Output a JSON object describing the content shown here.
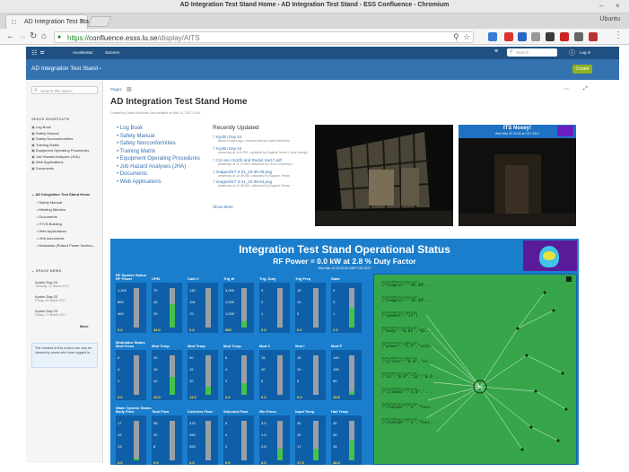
{
  "window": {
    "title": "AD Integration Test Stand Home - AD Integration Test Stand - ESS Confluence - Chromium",
    "profile": "Ubuntu"
  },
  "tab": {
    "title": "AD Integration Test Sta"
  },
  "address": {
    "url": "https://confluence.esss.lu.se/display/AITS",
    "url_scheme": "https://",
    "url_host": "confluence.esss.lu.se",
    "url_path": "/display/AITS"
  },
  "confluence_nav": {
    "items": [
      "Accelerator",
      "Science"
    ],
    "search_placeholder": "Search",
    "login": "Log in"
  },
  "space": {
    "name": "AD Integration Test Stand",
    "create": "Create"
  },
  "sidebar": {
    "search_placeholder": "Search this space",
    "shortcuts_heading": "SPACE SHORTCUTS",
    "shortcuts": [
      "Log Book",
      "Safety Manual",
      "Safety Nonconformities",
      "Training Matrix",
      "Equipment Operating Procedures",
      "Job Hazard Analyses (JHA)",
      "Web Applications",
      "Documents"
    ],
    "tree_root": "AD Integration Test Stand Home",
    "tree_children": [
      "Safety Manual",
      "Meeting Minutes",
      "Documents",
      "ITS B Building",
      "Web Applications",
      "JHA documents",
      "Modulator (Pulsed Power Section..."
    ],
    "news_heading": "SPACE NEWS",
    "news": [
      {
        "title": "Kyahn Day 24",
        "date": "Tuesday, 21 March 2017"
      },
      {
        "title": "Kyahn Day 22",
        "date": "Friday, 10 March 2017"
      },
      {
        "title": "Kyahn Day 23",
        "date": "Friday, 17 March 2017"
      }
    ],
    "news_more": "More",
    "notice": "The content of this macro can only be viewed by users who have logged in."
  },
  "page": {
    "breadcrumb": "Pages",
    "title": "AD Integration Test Stand Home",
    "byline": "Created by David McGinnis, last modified on Mar 24, 2017 10:51",
    "links": [
      "Log Book",
      "Safety Manual",
      "Safety Nonconformities",
      "Training Matrix",
      "Equipment Operating Procedures",
      "Job Hazard Analyses (JHA)",
      "Documents",
      "Web Applications"
    ],
    "recent_heading": "Recently Updated",
    "recent": [
      {
        "title": "Kyahn Day 24",
        "sub": "about 5 hours ago • commented by David McGinnis"
      },
      {
        "title": "Kyahn Day 24",
        "sub": "yesterday at 3:44 PM • updated by Eugene Tereia • view change"
      },
      {
        "title": "Cxl van cts10b and Radiot ree17.pdf",
        "sub": "yesterday at 11:13 AM • attached by Linus Johansson"
      },
      {
        "title": "image2017-3-21_10-39-35.png",
        "sub": "yesterday at 10:39 AM • attached by Eugene Tereia"
      },
      {
        "title": "image2017-3-21_10-38-54.png",
        "sub": "yesterday at 10:38 AM • attached by Eugene Tereia"
      }
    ],
    "show_more": "Show More",
    "its_title": "ITS Nosey!",
    "its_date": "Wed Mar 22 22:00 at CET 2017"
  },
  "dashboard": {
    "title": "Integration Test Stand Operational Status",
    "subtitle": "RF Power = 0.0 kW at 2.8 % Duty Factor",
    "timestamp": "Wed Mar 22 22:00:00 GMT+100 2017",
    "sections": [
      {
        "label": "RF System Status",
        "gauges": [
          {
            "label": "RF Power",
            "ticks": [
              "1,200",
              "800",
              "400"
            ],
            "value": "0.0",
            "level": 0.0
          },
          {
            "label": "CPM",
            "ticks": [
              "70",
              "40",
              "20"
            ],
            "value": "44.0",
            "level": 0.6
          },
          {
            "label": "Cath V",
            "ticks": [
              "140",
              "115",
              "70"
            ],
            "value": "0.0",
            "level": 0.0
          },
          {
            "label": "Trig W",
            "ticks": [
              "3,000",
              "2,000",
              "1,000"
            ],
            "value": "500",
            "level": 0.15
          },
          {
            "label": "Trig. Duty",
            "ticks": [
              "3",
              "2",
              "1"
            ],
            "value": "0.0",
            "level": 0.0
          },
          {
            "label": "Trig Freq",
            "ticks": [
              "15",
              "10",
              "5"
            ],
            "value": "0.0",
            "level": 0.0
          },
          {
            "label": "State",
            "ticks": [
              "4",
              "3",
              "1"
            ],
            "value": "2.0",
            "level": 0.5
          }
        ]
      },
      {
        "label": "Modulator Status",
        "gauges": [
          {
            "label": "Mod Press",
            "ticks": [
              "6",
              "4",
              "2"
            ],
            "value": "0.0",
            "level": 0.0
          },
          {
            "label": "Mod Temp",
            "ticks": [
              "20",
              "15",
              "10"
            ],
            "value": "16.0",
            "level": 0.45
          },
          {
            "label": "Mod Temp",
            "ticks": [
              "20",
              "15",
              "10"
            ],
            "value": "12.6",
            "level": 0.2
          },
          {
            "label": "Mod Temp",
            "ticks": [
              "6",
              "4",
              "2"
            ],
            "value": "2.0",
            "level": 0.3
          },
          {
            "label": "Mod V",
            "ticks": [
              "15",
              "10",
              "5"
            ],
            "value": "0.0",
            "level": 0.0
          },
          {
            "label": "Mod I",
            "ticks": [
              "15",
              "10",
              "5"
            ],
            "value": "0.0",
            "level": 0.0
          },
          {
            "label": "Mod P",
            "ticks": [
              "140",
              "100",
              "60"
            ],
            "value": "19.8",
            "level": 0.1
          }
        ]
      },
      {
        "label": "Water System Status",
        "gauges": [
          {
            "label": "Body Flow",
            "ticks": [
              "17",
              "15",
              "13"
            ],
            "value": "0.0",
            "level": 0.05
          },
          {
            "label": "Tank Flow",
            "ticks": [
              "55",
              "20",
              "8"
            ],
            "value": "0.0",
            "level": 0.0
          },
          {
            "label": "Collector Flow",
            "ticks": [
              "375",
              "290",
              "200"
            ],
            "value": "0.0",
            "level": 0.0
          },
          {
            "label": "Solenoid Flow",
            "ticks": [
              "5",
              "4",
              "2"
            ],
            "value": "0.0",
            "level": 0.0
          },
          {
            "label": "Rtn Press.",
            "ticks": [
              "3.0",
              "1.5",
              "0.8"
            ],
            "value": "0.0",
            "level": 0.3
          },
          {
            "label": "Input Temp",
            "ticks": [
              "30",
              "20",
              "17"
            ],
            "value": "17.3",
            "level": 0.3
          },
          {
            "label": "Hall Temp",
            "ticks": [
              "40",
              "30",
              "15"
            ],
            "value": "40.0",
            "level": 0.5
          }
        ]
      }
    ],
    "node_lines": [
      "{\"tempCel\":\"20.30\"...",
      "{\"tempCel\":\"20.30\"...",
      "{\"cpmSet\":\"15\"}",
      "{\"body\":\"0.65\",\"O2...",
      "{\"power\":\"1.5\",\"inte...",
      "{\"plinez\":\"0.0\",\"in...",
      "{\"ip\":\"0.0\",\"ip\":\"0.0...",
      "{\"ctimdat\":\"3.0\",\"...",
      "{\"stateDr\":\"3\",\"faus...",
      "{\"stateDr\":\"3\",\"faus..."
    ],
    "node_topic": "itsTestMonitor/get/rem"
  }
}
